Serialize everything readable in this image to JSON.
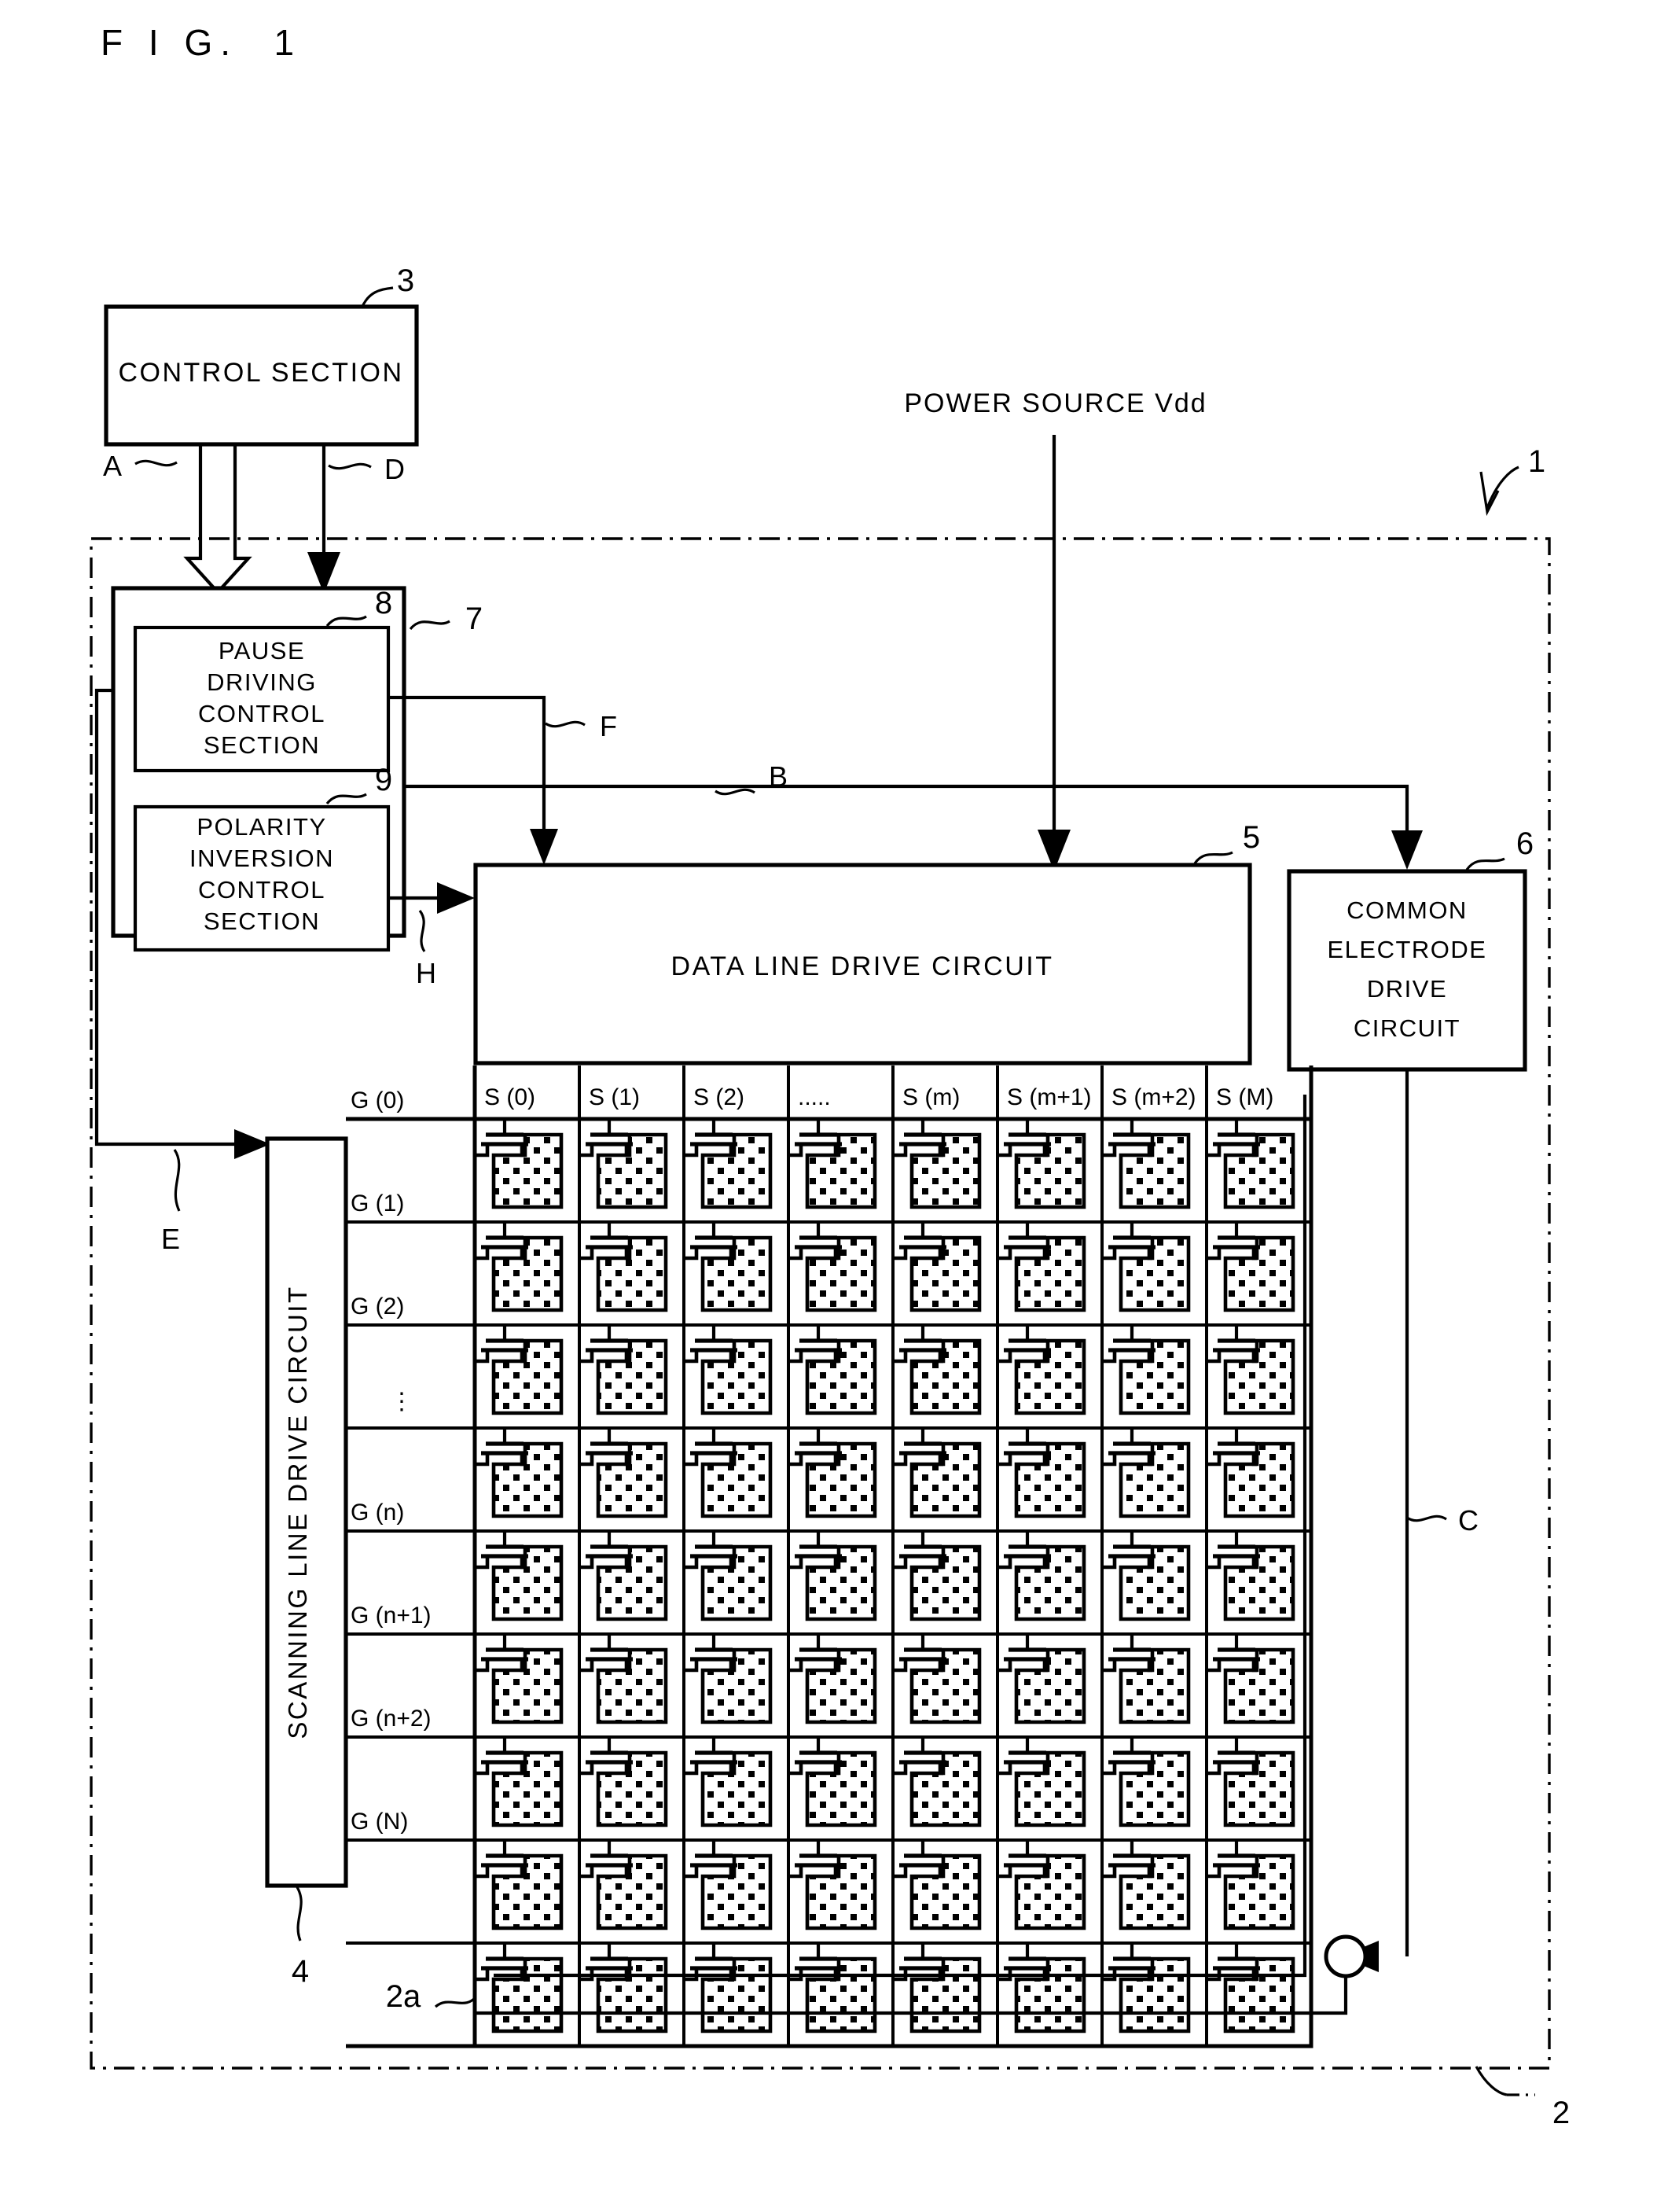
{
  "figure": {
    "title": "F I G.  1"
  },
  "blocks": {
    "control_section": {
      "label": "CONTROL SECTION",
      "ref": "3"
    },
    "pause_driving": {
      "lines": [
        "PAUSE",
        "DRIVING",
        "CONTROL",
        "SECTION"
      ],
      "ref": "8"
    },
    "polarity_inversion": {
      "lines": [
        "POLARITY",
        "INVERSION",
        "CONTROL",
        "SECTION"
      ],
      "ref": "9"
    },
    "driver_group": {
      "ref": "7"
    },
    "data_line_drive": {
      "label": "DATA LINE DRIVE CIRCUIT",
      "ref": "5"
    },
    "common_electrode_drive": {
      "lines": [
        "COMMON",
        "ELECTRODE",
        "DRIVE",
        "CIRCUIT"
      ],
      "ref": "6"
    },
    "scanning_line_drive": {
      "label": "SCANNING LINE DRIVE CIRCUIT",
      "ref": "4"
    },
    "panel_outer": {
      "ref": "1"
    },
    "panel_inner": {
      "ref": "2"
    },
    "pixel_array": {
      "ref": "2a"
    }
  },
  "power": {
    "label": "POWER SOURCE Vdd"
  },
  "signals": {
    "a": "A",
    "b": "B",
    "c": "C",
    "d": "D",
    "e": "E",
    "f": "F",
    "h": "H"
  },
  "data_lines": [
    "S (0)",
    "S (1)",
    "S (2)",
    ".....",
    "S (m)",
    "S (m+1)",
    "S (m+2)",
    "S (M)"
  ],
  "scan_lines": [
    "G (0)",
    "G (1)",
    "G (2)",
    "⋮",
    "G (n)",
    "G (n+1)",
    "G (n+2)",
    "G (N)"
  ],
  "colors": {
    "stroke": "#000000",
    "background": "#ffffff",
    "pixel_fill": "#ffffff",
    "pixel_dot": "#000000"
  }
}
